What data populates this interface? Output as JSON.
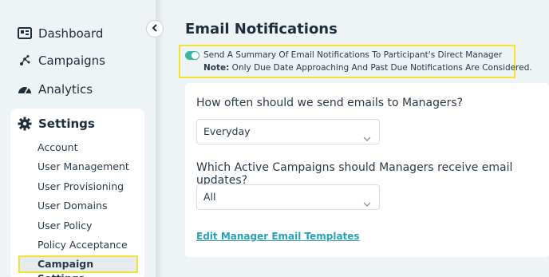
{
  "sidebar": {
    "items": [
      {
        "label": "Dashboard",
        "icon": "dashboard-icon"
      },
      {
        "label": "Campaigns",
        "icon": "campaigns-icon"
      },
      {
        "label": "Analytics",
        "icon": "analytics-icon"
      }
    ],
    "settings": {
      "label": "Settings",
      "icon": "gear-icon",
      "sub_items": [
        "Account",
        "User Management",
        "User Provisioning",
        "User Domains",
        "User Policy",
        "Policy Acceptance",
        "Campaign Settings"
      ],
      "active": "Campaign Settings"
    }
  },
  "main": {
    "title": "Email Notifications",
    "notice": {
      "toggle_on": true,
      "line1": "Send A Summary Of Email Notifications To Participant's Direct Manager",
      "note_label": "Note:",
      "note_text": " Only Due Date Approaching And Past Due Notifications Are Considered."
    },
    "frequency": {
      "question": "How often should we send emails to Managers?",
      "selected": "Everyday"
    },
    "campaigns": {
      "question": "Which Active Campaigns should Managers receive email updates?",
      "selected": "All"
    },
    "edit_link": "Edit Manager Email Templates"
  },
  "colors": {
    "accent": "#3bb7a0",
    "link": "#2a9fb8",
    "highlight": "#f2e233"
  }
}
